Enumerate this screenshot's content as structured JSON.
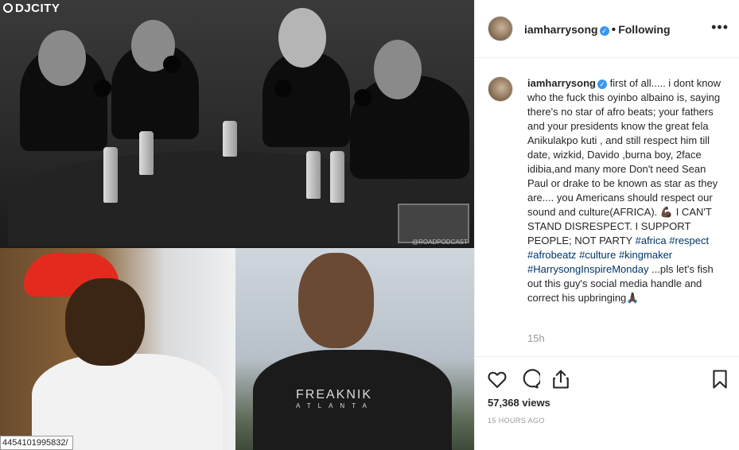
{
  "media": {
    "dj_logo": "DJCITY",
    "shirt_text": "FREAKNIK",
    "shirt_subtext": "ATLANTA",
    "url_fragment": "4454101995832/"
  },
  "header": {
    "username": "iamharrysong",
    "following_label": "Following",
    "more_icon": "more-horizontal-icon"
  },
  "caption": {
    "username": "iamharrysong",
    "text_1": "first of all..... i dont know who the fuck this oyinbo albaino is, saying there's no star of afro beats; your fathers and your presidents know the great fela Anikulakpo kuti , and still respect him till date, wizkid, Davido ,burna boy, 2face idibia,and many more Don't need Sean Paul or drake to be known as star as they are.... you Americans should respect our sound and culture(AFRICA). 💪🏿 I CAN'T STAND DISRESPECT. I SUPPORT PEOPLE; NOT PARTY",
    "tags": [
      "#africa",
      "#respect",
      "#afrobeatz",
      "#culture",
      "#kingmaker",
      "#HarrysongInspireMonday"
    ],
    "text_2": "...pls let's fish out this guy's social media handle and correct his upbringing🙏🏿",
    "time_ago": "15h"
  },
  "footer": {
    "views": "57,368 views",
    "date": "15 HOURS AGO"
  }
}
